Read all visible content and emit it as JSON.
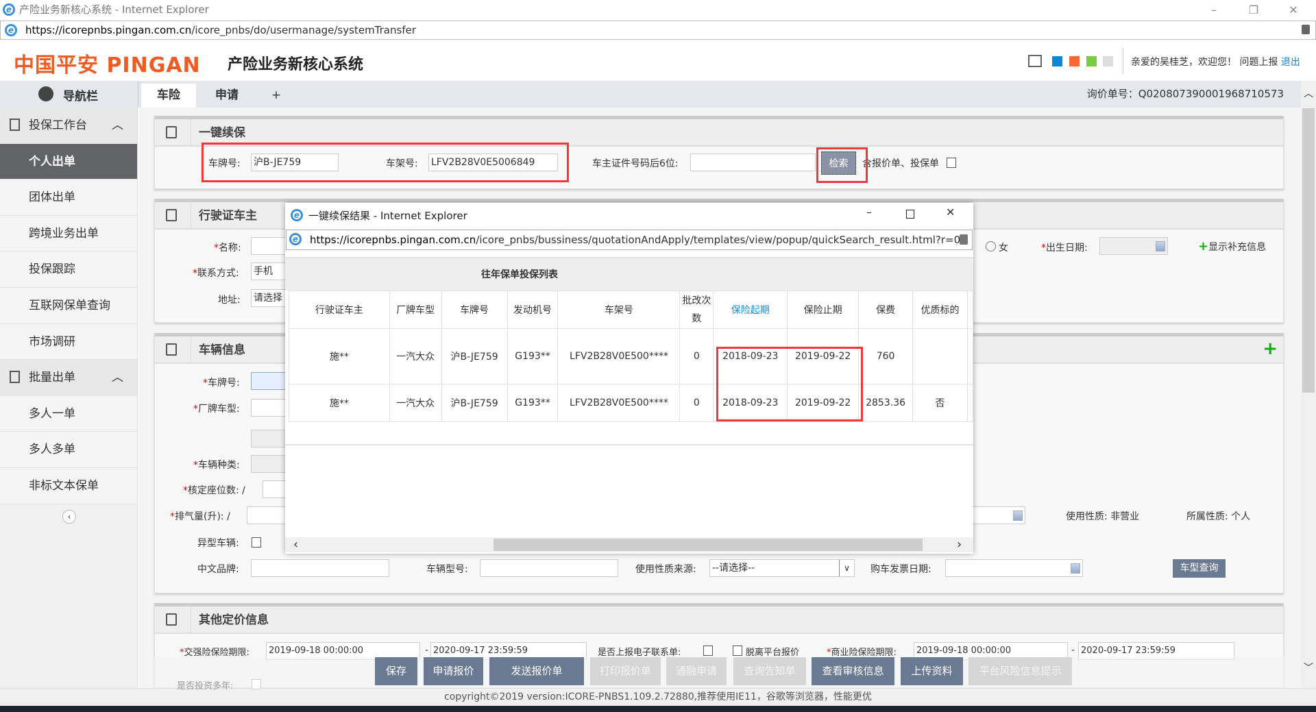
{
  "window": {
    "title": "产险业务新核心系统 - Internet Explorer",
    "url_host": "https://icorepnbs.pingan.com.cn",
    "url_path": "/icore_pnbs/do/usermanage/systemTransfer",
    "min": "–",
    "restore": "❐",
    "close": "✕"
  },
  "header": {
    "logo": "中国平安 PINGAN",
    "system_name": "产险业务新核心系统",
    "greeting": "亲爱的吴桂芝，欢迎您！",
    "report_issue": "问题上报",
    "logout": "退出",
    "theme_colors": [
      "#0a88d6",
      "#ff6633",
      "#77cc44",
      "#dddddd"
    ]
  },
  "nav": {
    "title": "导航栏",
    "tabs": [
      "车险",
      "申请",
      "+"
    ],
    "inquiry_no": "询价单号：Q020807390001968710573"
  },
  "sidebar": {
    "groups": [
      {
        "label": "投保工作台",
        "items": [
          "个人出单",
          "团体出单",
          "跨境业务出单",
          "投保跟踪",
          "互联网保单查询",
          "市场调研"
        ]
      },
      {
        "label": "批量出单",
        "items": [
          "多人一单",
          "多人多单",
          "非标文本保单"
        ]
      }
    ],
    "active": "个人出单"
  },
  "renew": {
    "title": "一键续保",
    "plate_label": "车牌号:",
    "plate_value": "沪B-JE759",
    "vin_label": "车架号:",
    "vin_value": "LFV2B28V0E5006849",
    "id_label": "车主证件号码后6位:",
    "id_value": "",
    "search": "检索",
    "include_label": "含报价单、投保单"
  },
  "owner": {
    "title": "行驶证车主",
    "name_label": "名称:",
    "contact_label": "联系方式:",
    "contact_value": "手机",
    "address_label": "地址:",
    "address_value": "请选择",
    "female": "女",
    "birth_label": "出生日期:",
    "show_more": "显示补充信息"
  },
  "vehicle": {
    "title": "车辆信息",
    "plate_label": "车牌号:",
    "model_label": "厂牌车型:",
    "kind_label": "车辆种类:",
    "seats_label": "核定座位数:",
    "displacement_label": "排气量(升):",
    "slash": "/",
    "special_label": "异型车辆:",
    "use_label": "使用性质:",
    "use_value": "非营业",
    "owner_type_label": "所属性质:",
    "owner_type_value": "个人",
    "brand_label": "中文品牌:",
    "type_no_label": "车辆型号:",
    "use_source_label": "使用性质来源:",
    "use_source_value": "--请选择--",
    "invoice_label": "购车发票日期:",
    "model_query": "车型查询"
  },
  "pricing": {
    "title": "其他定价信息",
    "ctpl_label": "交强险保险期限:",
    "ctpl_start": "2019-09-18 00:00:00",
    "ctpl_end": "2020-09-17 23:59:59",
    "e_contact_label": "是否上报电子联系单:",
    "offline_label": "脱离平台报价",
    "comm_label": "商业险保险期限:",
    "comm_start": "2019-09-18 00:00:00",
    "comm_end": "2020-09-17 23:59:59",
    "multi_year_label": "是否投资多年:"
  },
  "actions": [
    {
      "label": "保存",
      "enabled": true
    },
    {
      "label": "申请报价",
      "enabled": true
    },
    {
      "label": "发送报价单",
      "enabled": true
    },
    {
      "label": "打印报价单",
      "enabled": false
    },
    {
      "label": "通融申请",
      "enabled": false
    },
    {
      "label": "查询告知单",
      "enabled": false
    },
    {
      "label": "查看审核信息",
      "enabled": true
    },
    {
      "label": "上传资料",
      "enabled": true
    },
    {
      "label": "平台风险信息提示",
      "enabled": false
    }
  ],
  "popup": {
    "title": "一键续保结果 - Internet Explorer",
    "url_host": "https://icorepnbs.pingan.com.cn",
    "url_path": "/icore_pnbs/bussiness/quotationAndApply/templates/view/popup/quickSearch_result.html?r=0.",
    "table_title": "往年保单投保列表",
    "columns": [
      "行驶证车主",
      "厂牌车型",
      "车牌号",
      "发动机号",
      "车架号",
      "批改次数",
      "保险起期",
      "保险止期",
      "保费",
      "优质标的"
    ],
    "rows": [
      [
        "施**",
        "一汽大众",
        "沪B-JE759",
        "G193**",
        "LFV2B28V0E500****",
        "0",
        "2018-09-23",
        "2019-09-22",
        "760",
        ""
      ],
      [
        "施**",
        "一汽大众",
        "沪B-JE759",
        "G193**",
        "LFV2B28V0E500****",
        "0",
        "2018-09-23",
        "2019-09-22",
        "2853.36",
        "否"
      ]
    ]
  },
  "footer": {
    "copyright": "copyright©2019 version:ICORE-PNBS1.109.2.72880,推荐使用IE11，谷歌等浏览器，性能更优"
  }
}
